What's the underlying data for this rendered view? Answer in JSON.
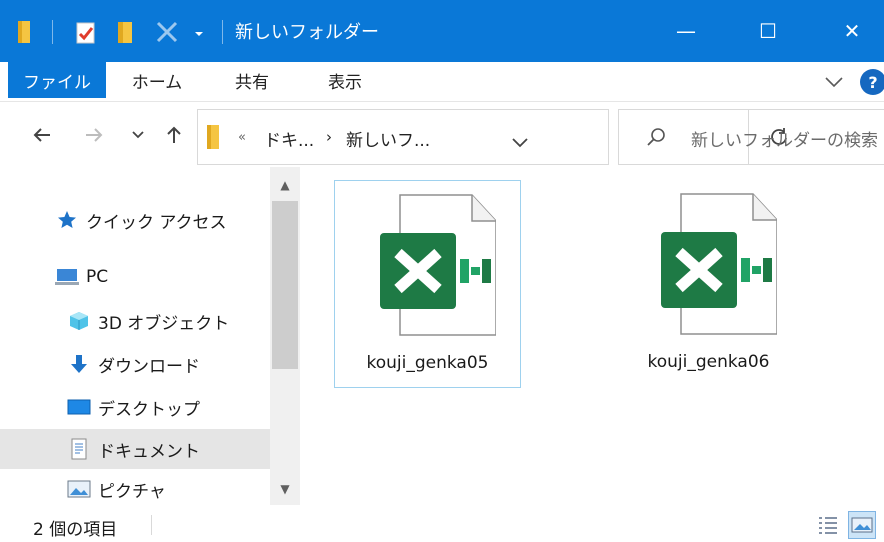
{
  "window": {
    "title": "新しいフォルダー",
    "minimize": "—",
    "maximize": "☐",
    "close": "✕"
  },
  "ribbon": {
    "tabs": [
      "ファイル",
      "ホーム",
      "共有",
      "表示"
    ],
    "help": "?"
  },
  "address": {
    "overflow": "«",
    "crumbs": [
      "ドキ...",
      "新しいフ..."
    ],
    "search_placeholder": "新しいフォルダーの検索"
  },
  "nav": {
    "items": [
      "クイック アクセス",
      "PC",
      "3D オブジェクト",
      "ダウンロード",
      "デスクトップ",
      "ドキュメント",
      "ピクチャ"
    ]
  },
  "files": [
    {
      "name": "kouji_genka05",
      "selected": true
    },
    {
      "name": "kouji_genka06",
      "selected": false
    }
  ],
  "status": {
    "text": "2 個の項目"
  },
  "colors": {
    "accent": "#0a78d7",
    "excel_green": "#1e7a45",
    "excel_light": "#21a366"
  }
}
